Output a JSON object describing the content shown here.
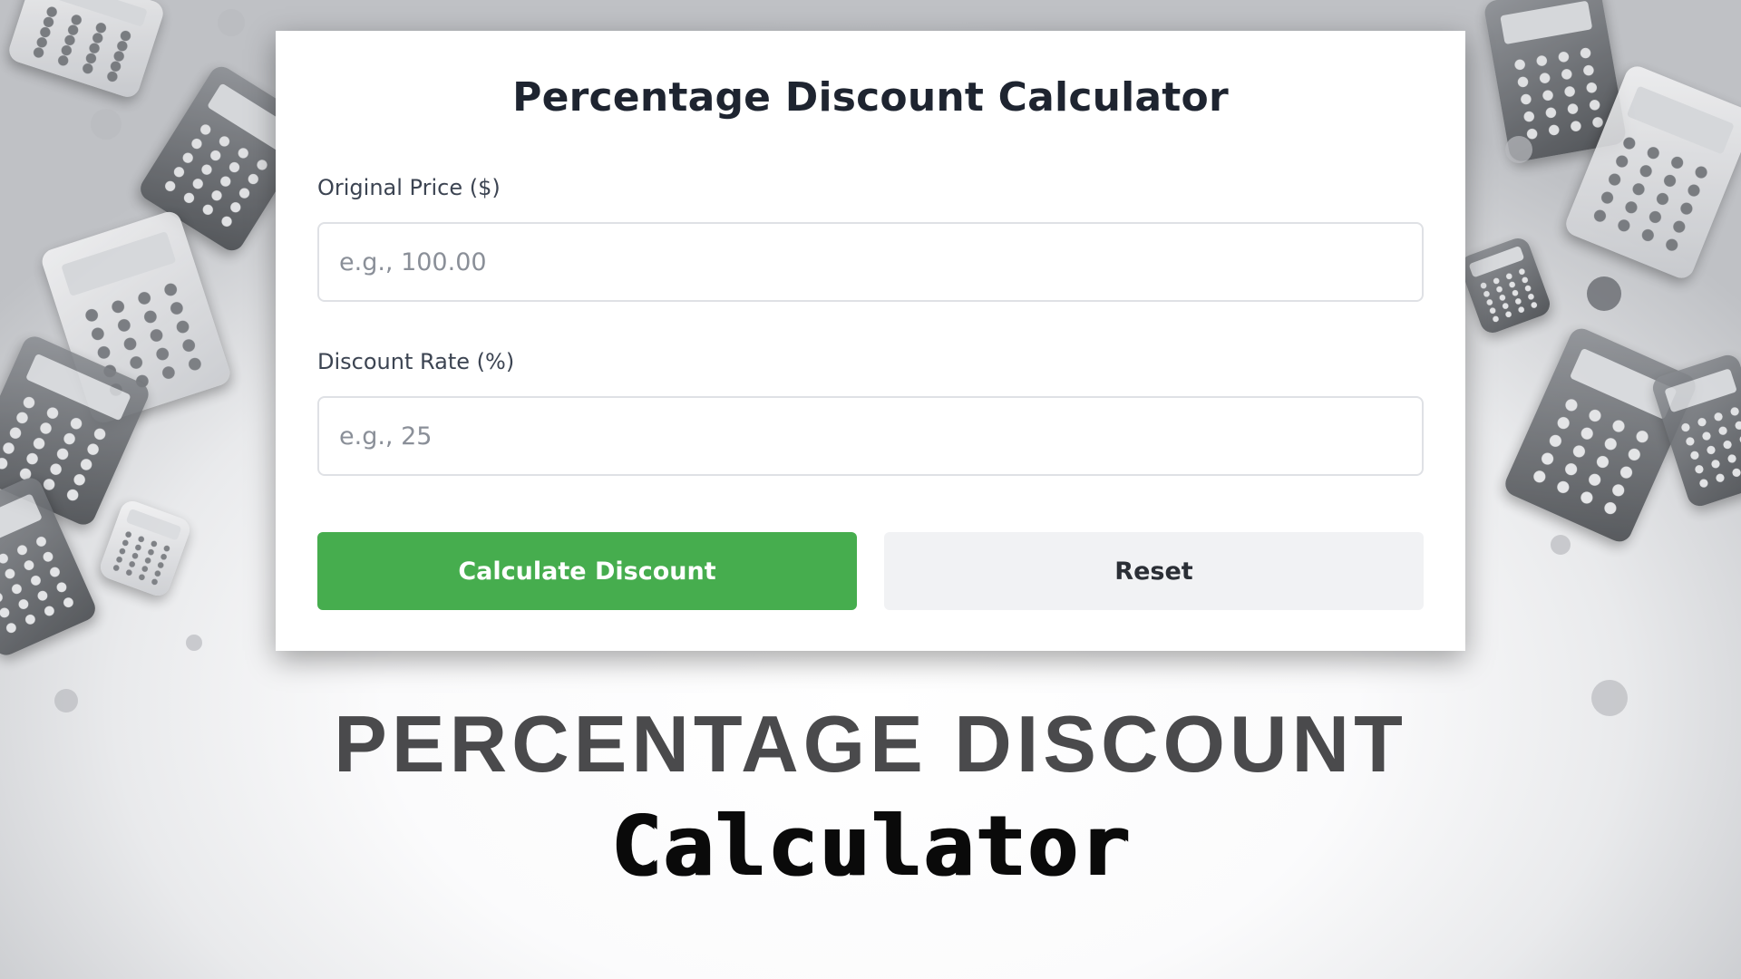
{
  "card": {
    "title": "Percentage Discount Calculator",
    "price_label": "Original Price ($)",
    "price_placeholder": "e.g., 100.00",
    "price_value": "",
    "rate_label": "Discount Rate (%)",
    "rate_placeholder": "e.g., 25",
    "rate_value": "",
    "calculate_label": "Calculate Discount",
    "reset_label": "Reset"
  },
  "banner": {
    "headline": "PERCENTAGE DISCOUNT",
    "subheadline": "Calculator"
  },
  "colors": {
    "primary_button": "#46ad4e",
    "secondary_button": "#f1f2f4",
    "title_text": "#1e2430"
  },
  "background": {
    "icon": "calculators-scatter-icon"
  }
}
